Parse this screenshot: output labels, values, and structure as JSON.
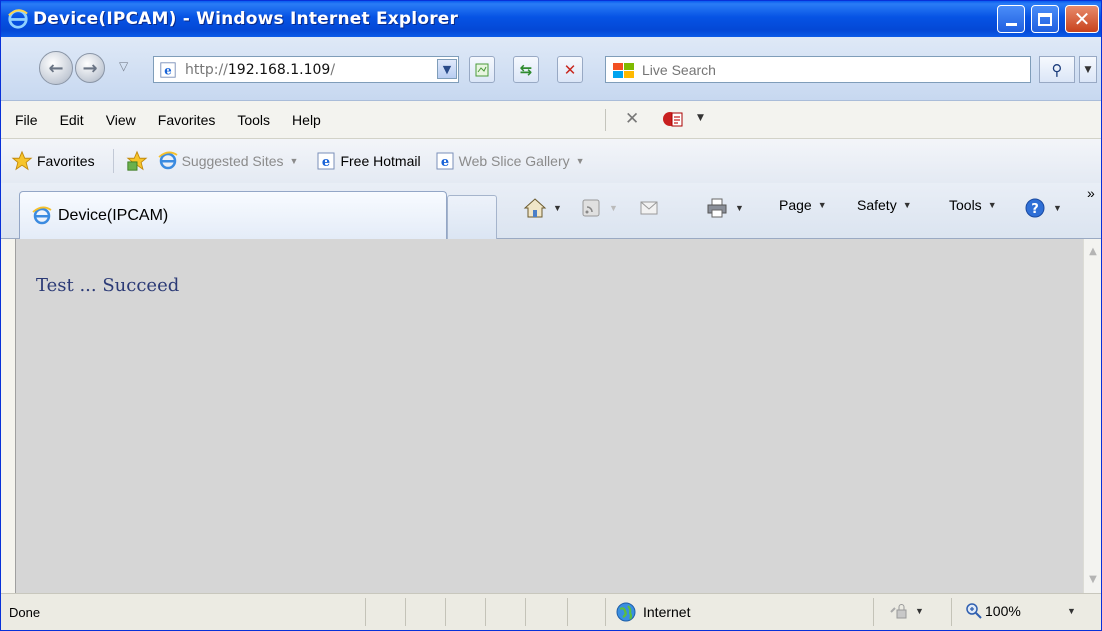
{
  "window": {
    "title": "Device(IPCAM) - Windows Internet Explorer",
    "controls": [
      "minimize",
      "maximize",
      "close"
    ]
  },
  "address_bar": {
    "url_prefix": "http://",
    "url_host": "192.168.1.109",
    "url_suffix": "/"
  },
  "search": {
    "placeholder": "Live Search"
  },
  "menu": {
    "items": [
      "File",
      "Edit",
      "View",
      "Favorites",
      "Tools",
      "Help"
    ]
  },
  "favorites_bar": {
    "favorites_label": "Favorites",
    "links": [
      {
        "label": "Suggested Sites",
        "has_dropdown": true,
        "dimmed": true
      },
      {
        "label": "Free Hotmail",
        "has_dropdown": false,
        "dimmed": false
      },
      {
        "label": "Web Slice Gallery",
        "has_dropdown": true,
        "dimmed": true
      }
    ]
  },
  "tabs": {
    "active_label": "Device(IPCAM)"
  },
  "command_bar": {
    "page_label": "Page",
    "safety_label": "Safety",
    "tools_label": "Tools",
    "overflow": "»"
  },
  "content": {
    "message": "Test ... Succeed",
    "background_color": "#d6d6d6",
    "text_color": "#2b3a76"
  },
  "status_bar": {
    "status": "Done",
    "zone": "Internet",
    "zoom": "100%"
  },
  "colors": {
    "titlebar_blue": "#0653e4",
    "close_red": "#c8421c"
  }
}
